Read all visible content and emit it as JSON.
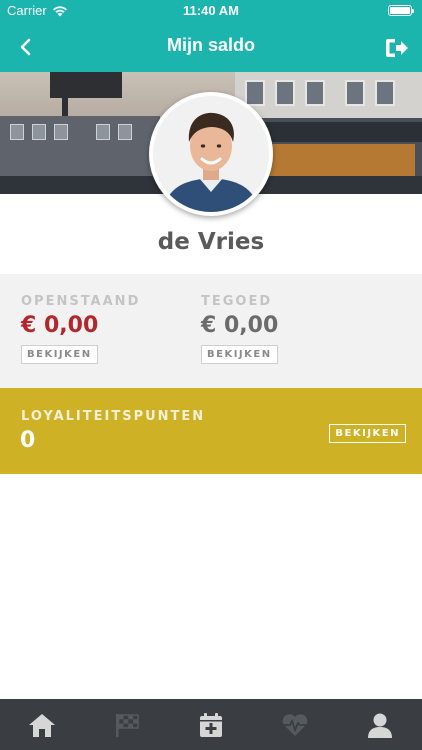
{
  "status_bar": {
    "carrier": "Carrier",
    "time": "11:40 AM",
    "battery_level": 1.0
  },
  "nav": {
    "title": "Mijn saldo",
    "back_icon": "chevron-left-icon",
    "logout_icon": "logout-icon"
  },
  "profile": {
    "name": "de Vries",
    "avatar": "avatar-photo"
  },
  "balance": {
    "outstanding": {
      "label": "OPENSTAAND",
      "value": "€ 0,00",
      "button": "BEKIJKEN",
      "color": "#b3262c"
    },
    "credit": {
      "label": "TEGOED",
      "value": "€ 0,00",
      "button": "BEKIJKEN",
      "color": "#6b6b6b"
    }
  },
  "loyalty": {
    "label": "LOYALITEITSPUNTEN",
    "value": "0",
    "button": "BEKIJKEN",
    "color": "#cfb125"
  },
  "colors": {
    "brand": "#1bb5ae",
    "tab_bar": "#3a3e42",
    "tab_active": "#d6d6d6",
    "tab_inactive": "#555a5f"
  },
  "tabs": [
    {
      "icon": "home-icon",
      "active": true
    },
    {
      "icon": "checkered-flag-icon",
      "active": false
    },
    {
      "icon": "calendar-add-icon",
      "active": true
    },
    {
      "icon": "heartbeat-icon",
      "active": false
    },
    {
      "icon": "user-icon",
      "active": true
    }
  ]
}
